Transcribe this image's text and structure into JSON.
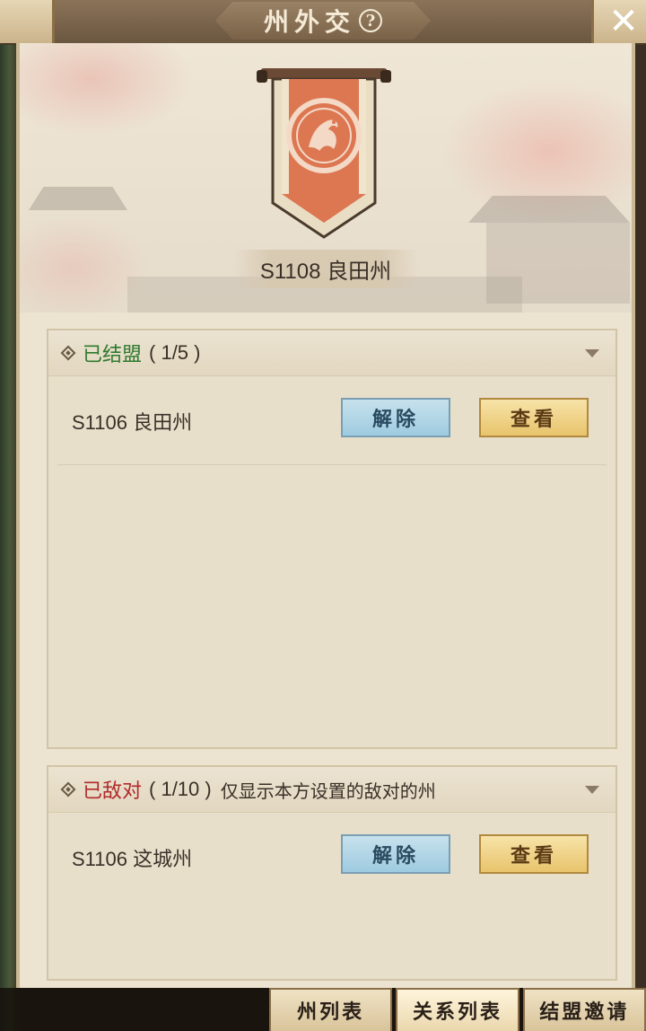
{
  "header": {
    "title": "州外交",
    "help_icon_glyph": "?",
    "close_icon": "close-icon"
  },
  "state": {
    "name": "S1108 良田州",
    "emblem_icon": "phoenix-emblem-icon"
  },
  "allied": {
    "title": "已结盟",
    "count": "( 1/5 )",
    "rows": [
      {
        "label": "S1106 良田州",
        "release": "解除",
        "view": "查看"
      }
    ]
  },
  "hostile": {
    "title": "已敌对",
    "count": "( 1/10 )",
    "note": "仅显示本方设置的敌对的州",
    "rows": [
      {
        "label": "S1106 这城州",
        "release": "解除",
        "view": "查看"
      }
    ]
  },
  "tabs": [
    {
      "label": "州列表"
    },
    {
      "label": "关系列表"
    },
    {
      "label": "结盟邀请"
    }
  ],
  "colors": {
    "allied_title": "#2f7a2f",
    "hostile_title": "#b02a2a",
    "release_button": "#9ecbe0",
    "view_button": "#e8c46c"
  }
}
